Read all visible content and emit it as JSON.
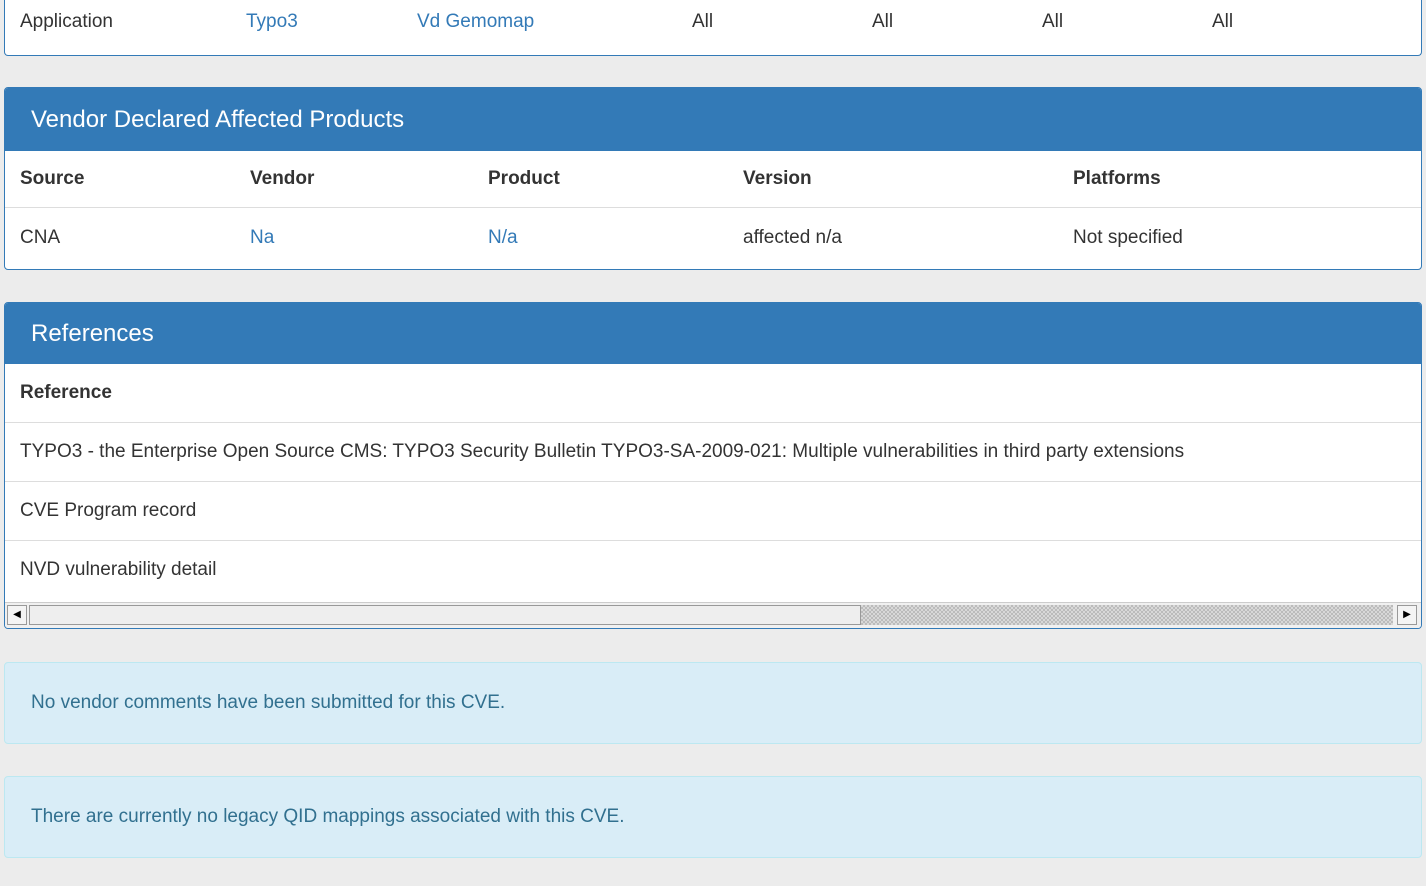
{
  "app_table": {
    "row": {
      "type": "Application",
      "vendor": "Typo3",
      "product": "Vd Gemomap",
      "col4": "All",
      "col5": "All",
      "col6": "All",
      "col7": "All"
    }
  },
  "vendor_panel": {
    "title": "Vendor Declared Affected Products",
    "headers": [
      "Source",
      "Vendor",
      "Product",
      "Version",
      "Platforms"
    ],
    "rows": [
      {
        "source": "CNA",
        "vendor": "Na",
        "product": "N/a",
        "version": "affected n/a",
        "platforms": "Not specified"
      }
    ]
  },
  "references_panel": {
    "title": "References",
    "header": "Reference",
    "rows": [
      "TYPO3 - the Enterprise Open Source CMS: TYPO3 Security Bulletin TYPO3-SA-2009-021: Multiple vulnerabilities in third party extensions",
      "CVE Program record",
      "NVD vulnerability detail"
    ],
    "scrollbar": {
      "left_arrow": "◀",
      "right_arrow": "▶"
    }
  },
  "alerts": {
    "vendor_comments": "No vendor comments have been submitted for this CVE.",
    "qid_mappings": "There are currently no legacy QID mappings associated with this CVE."
  }
}
